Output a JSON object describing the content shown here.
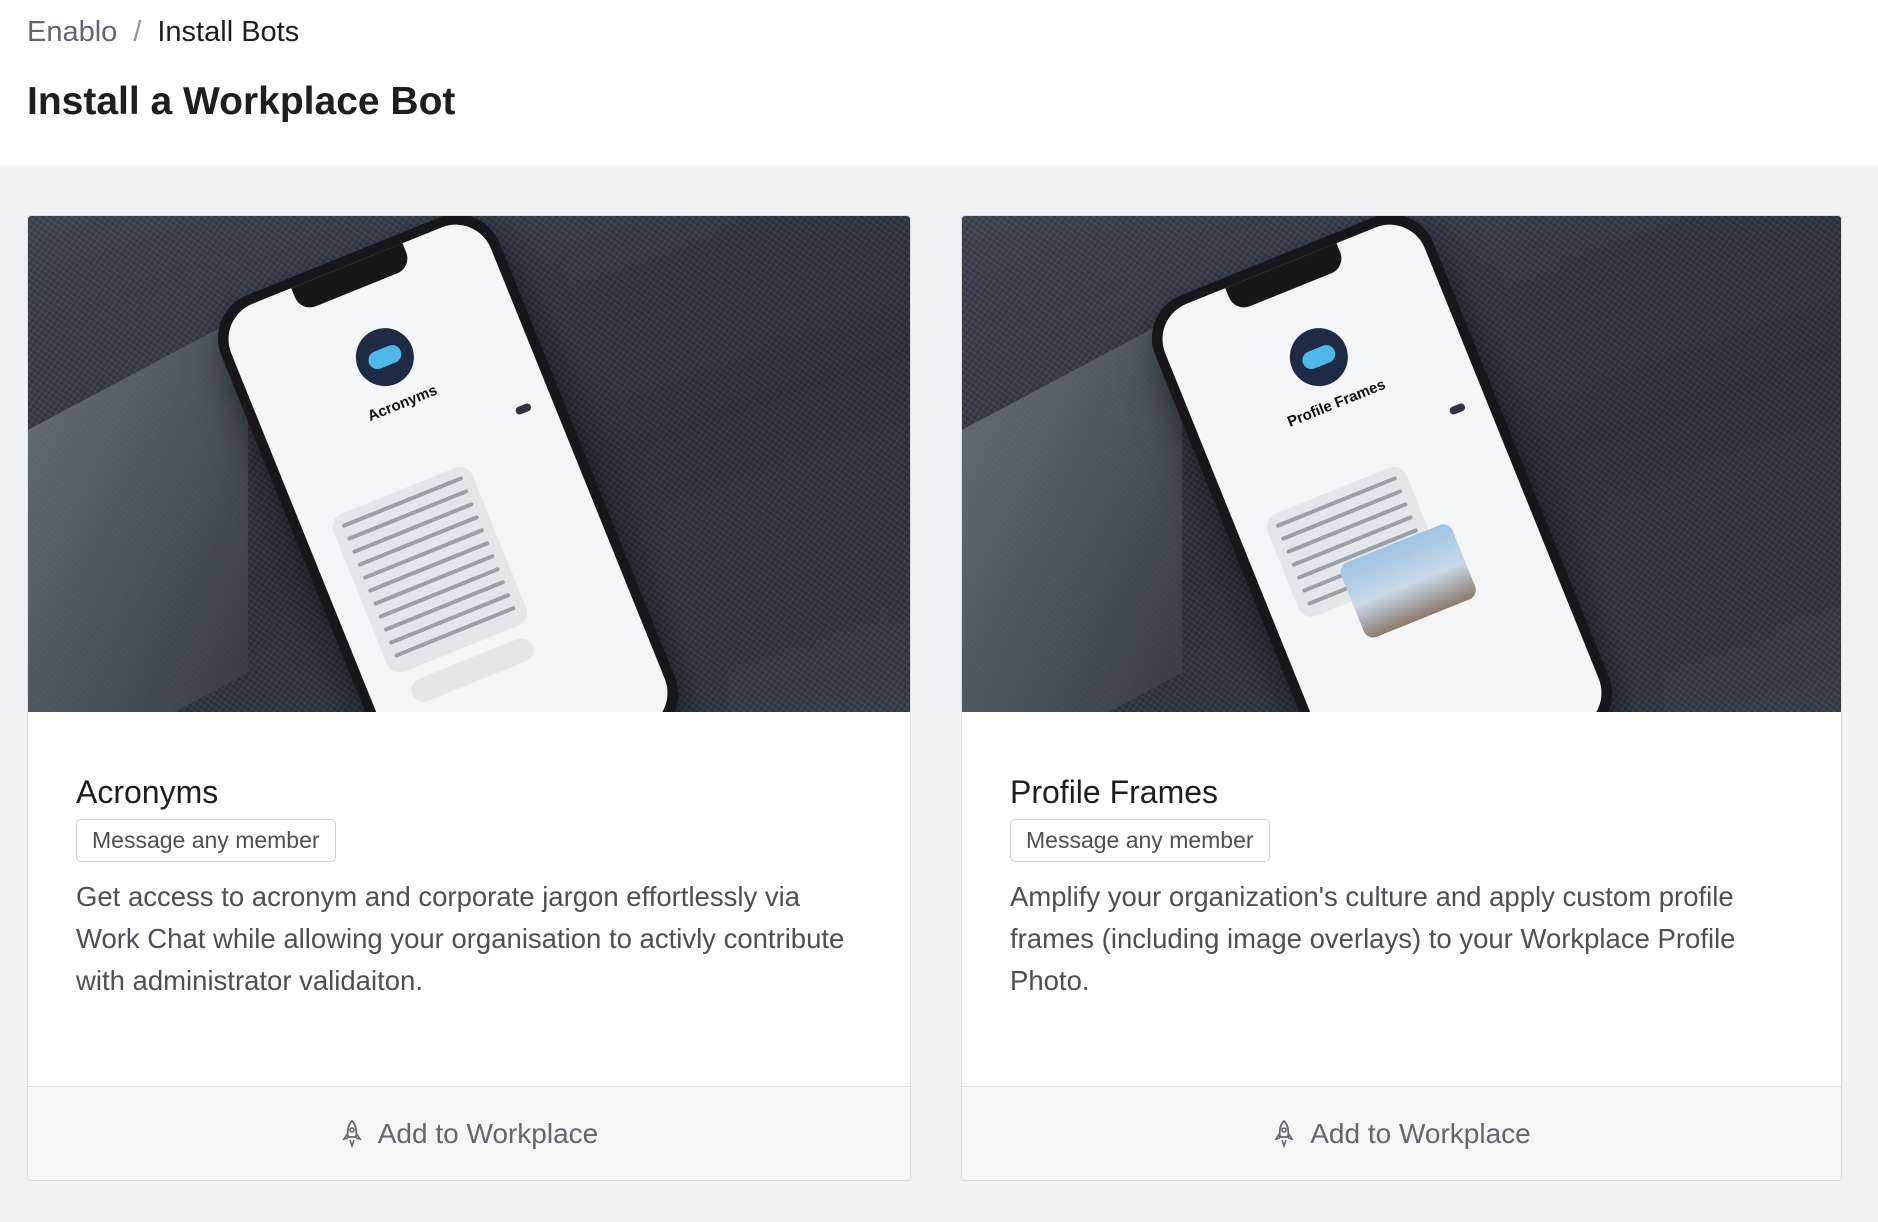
{
  "breadcrumb": {
    "root": "Enablo",
    "separator": "/",
    "current": "Install Bots"
  },
  "page_title": "Install a Workplace Bot",
  "bots": [
    {
      "name": "Acronyms",
      "badge": "Message any member",
      "description": "Get access to acronym and corporate jargon effortlessly via Work Chat while allowing your organisation to activly contribute with administrator validaiton.",
      "action_label": "Add to Workplace",
      "action_icon": "rocket-icon",
      "image_alt": "Phone showing Acronyms bot chat",
      "phone_title": "Acronyms"
    },
    {
      "name": "Profile Frames",
      "badge": "Message any member",
      "description": "Amplify your organization's culture and apply custom profile frames (including image overlays) to your Workplace Profile Photo.",
      "action_label": "Add to Workplace",
      "action_icon": "rocket-icon",
      "image_alt": "Phone showing Profile Frames bot chat",
      "phone_title": "Profile Frames"
    }
  ],
  "colors": {
    "background": "#f0f2f5",
    "card": "#ffffff",
    "footer": "#f5f6f7",
    "text": "#1c1e21",
    "muted": "#606770"
  }
}
